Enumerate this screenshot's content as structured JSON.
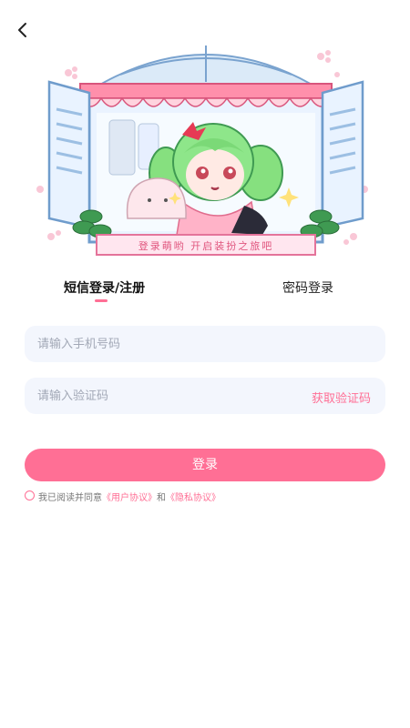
{
  "nav": {
    "back_icon": "chevron-left-icon"
  },
  "hero": {
    "banner_text": "登录萌哟 开启装扮之旅吧"
  },
  "tabs": [
    {
      "label": "短信登录/注册",
      "active": true
    },
    {
      "label": "密码登录",
      "active": false
    }
  ],
  "form": {
    "phone_placeholder": "请输入手机号码",
    "code_placeholder": "请输入验证码",
    "get_code_label": "获取验证码",
    "login_label": "登录"
  },
  "agreement": {
    "prefix": "我已阅读并同意",
    "user_link": "《用户协议》",
    "and": "和",
    "privacy_link": "《隐私协议》",
    "checked": false
  },
  "colors": {
    "accent": "#ff6f95",
    "field_bg": "#f3f6fd",
    "placeholder": "#a2a8b6"
  }
}
